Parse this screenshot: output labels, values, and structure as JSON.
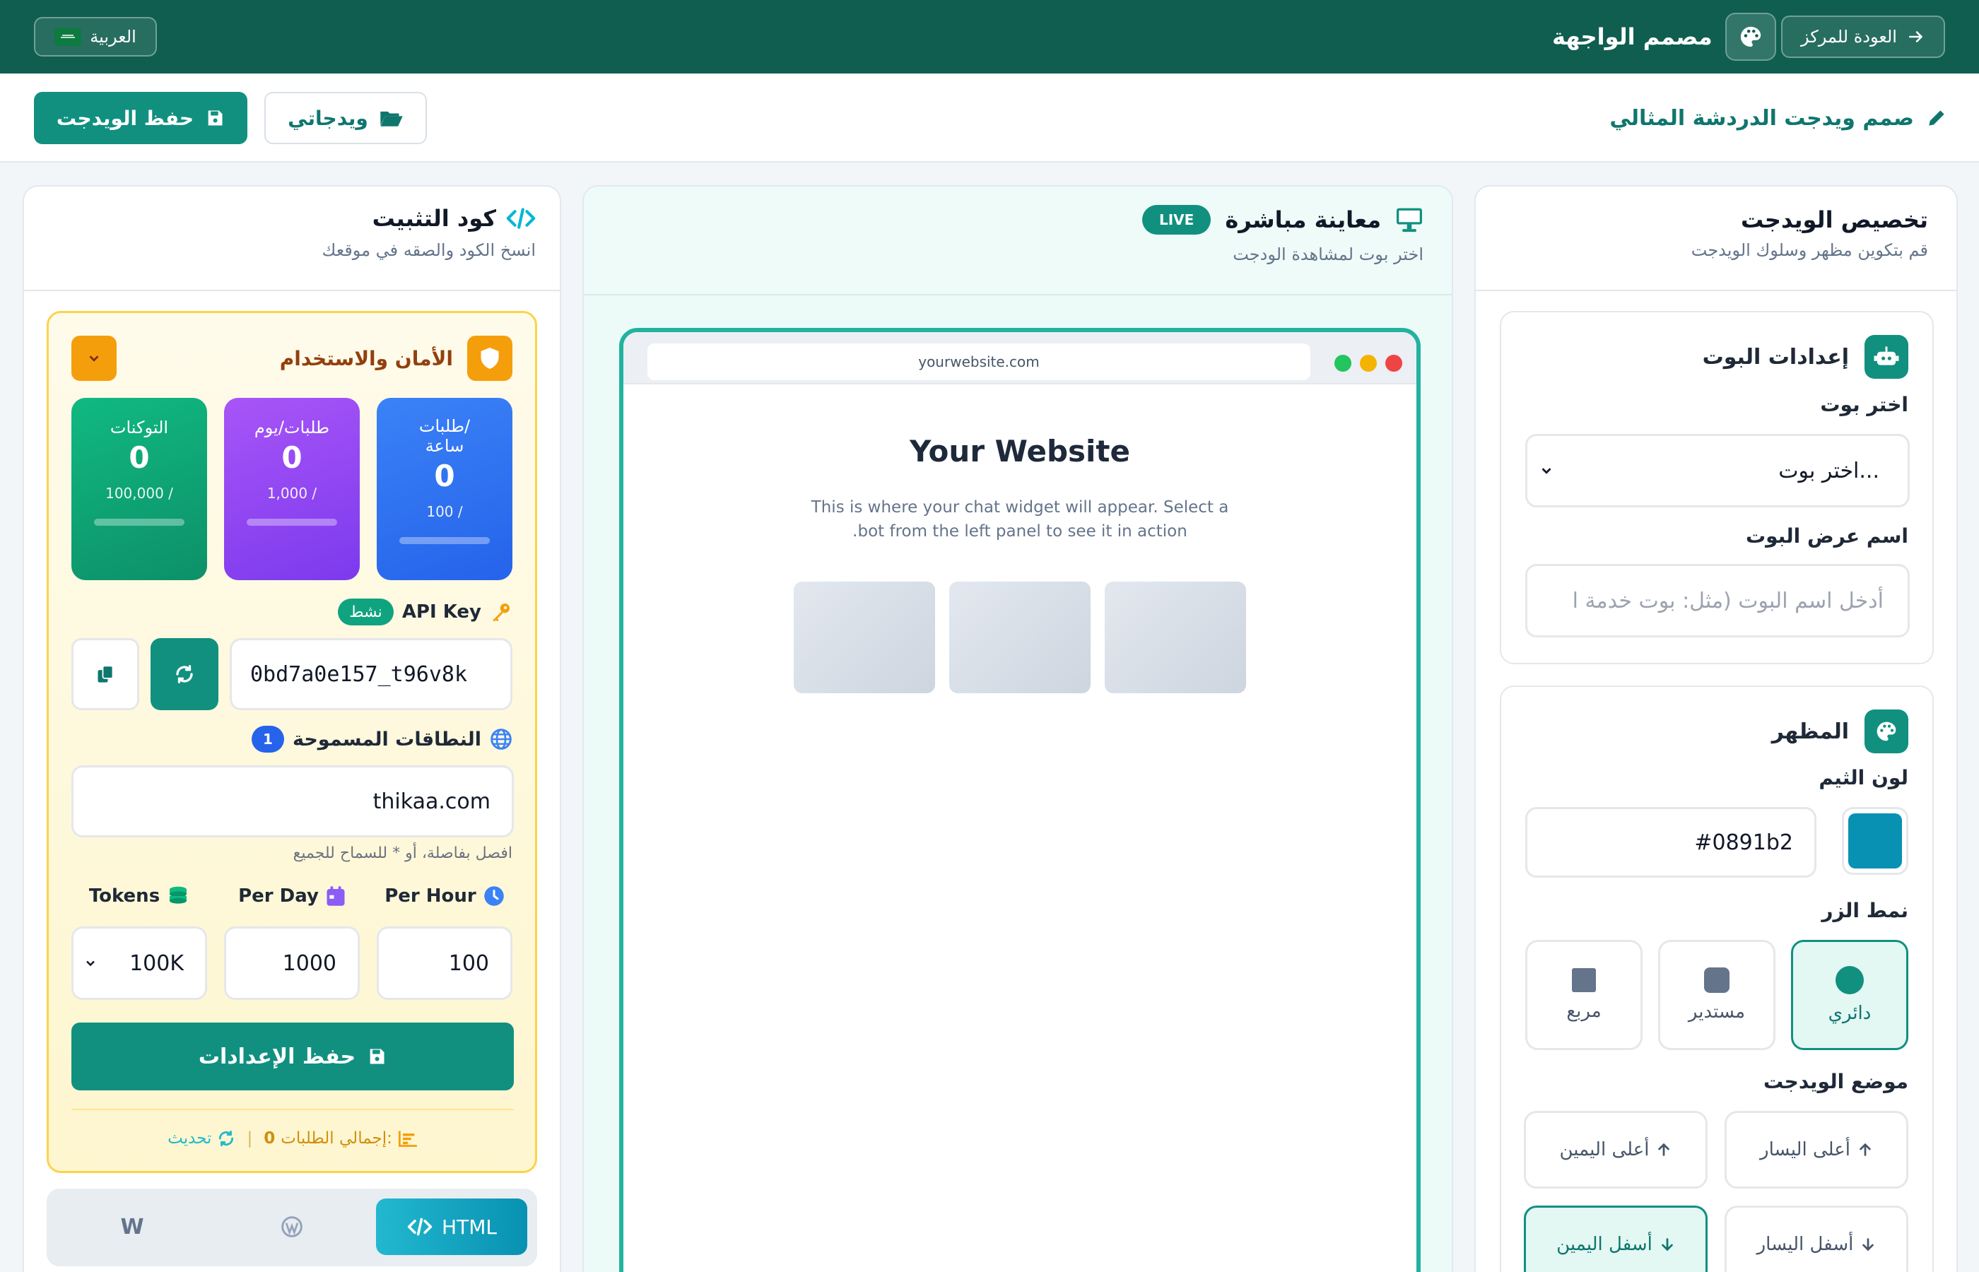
{
  "topbar": {
    "back_label": "العودة للمركز",
    "title": "مصمم الواجهة",
    "language_label": "العربية"
  },
  "subbar": {
    "heading": "صمم ويدجت الدردشة المثالي",
    "save_label": "حفظ الويدجت",
    "my_widgets_label": "ويدجاتي"
  },
  "customize": {
    "title": "تخصيص الويدجت",
    "subtitle": "قم بتكوين مظهر وسلوك الويدجت",
    "bot_settings": {
      "title": "إعدادات البوت",
      "select_label": "اختر بوت",
      "select_value": "اختر بوت...",
      "display_name_label": "اسم عرض البوت",
      "display_name_placeholder": "أدخل اسم البوت (مثل: بوت خدمة ا"
    },
    "appearance": {
      "title": "المظهر",
      "theme_color_label": "لون الثيم",
      "theme_color_value": "#0891b2",
      "button_style_label": "نمط الزر",
      "button_styles": [
        "دائري",
        "مستدير",
        "مربع"
      ],
      "selected_button_style": "دائري",
      "position_label": "موضع الويدجت",
      "positions": [
        "أعلى اليسار",
        "أعلى اليمين",
        "أسفل اليسار",
        "أسفل اليمين"
      ],
      "selected_position": "أسفل اليمين"
    }
  },
  "preview": {
    "title": "معاينة مباشرة",
    "badge": "LIVE",
    "subtitle": "اختر بوت لمشاهدة الودجت",
    "url": "yourwebsite.com",
    "site_title": "Your Website",
    "site_text_line1": "This is where your chat widget will appear. Select a",
    "site_text_line2": ".bot from the left panel to see it in action"
  },
  "install": {
    "title": "كود التثبيت",
    "subtitle": "انسخ الكود والصقه في موقعك",
    "security": {
      "title": "الأمان والاستخدام",
      "stats": [
        {
          "title": "التوكنات",
          "value": "0",
          "max": "100,000 /",
          "color": "#10a37f"
        },
        {
          "title": "طلبات/يوم",
          "value": "0",
          "max": "1,000 /",
          "color": "#8b5cf6"
        },
        {
          "title_line1": "طلبات/",
          "title_line2": "ساعة",
          "value": "0",
          "max": "100 /",
          "color": "#3b82f6"
        }
      ],
      "api_key_label": "API Key",
      "api_key_status": "نشط",
      "api_key_value": "0bd7a0e157_t96v8k",
      "domains_label": "النطاقات المسموحة",
      "domains_count": "1",
      "domains_value": "thikaa.com",
      "domains_hint": "افصل بفاصلة، أو * للسماح للجميع",
      "limits": {
        "per_hour_label": "Per Hour",
        "per_day_label": "Per Day",
        "tokens_label": "Tokens",
        "per_hour_value": "100",
        "per_day_value": "1000",
        "tokens_value": "100K"
      },
      "save_settings_label": "حفظ الإعدادات",
      "total_requests_label": "إجمالي الطلبات:",
      "total_requests_value": "0",
      "refresh_label": "تحديث"
    },
    "tabs": [
      "HTML",
      "",
      "W"
    ],
    "selected_tab": "HTML"
  }
}
